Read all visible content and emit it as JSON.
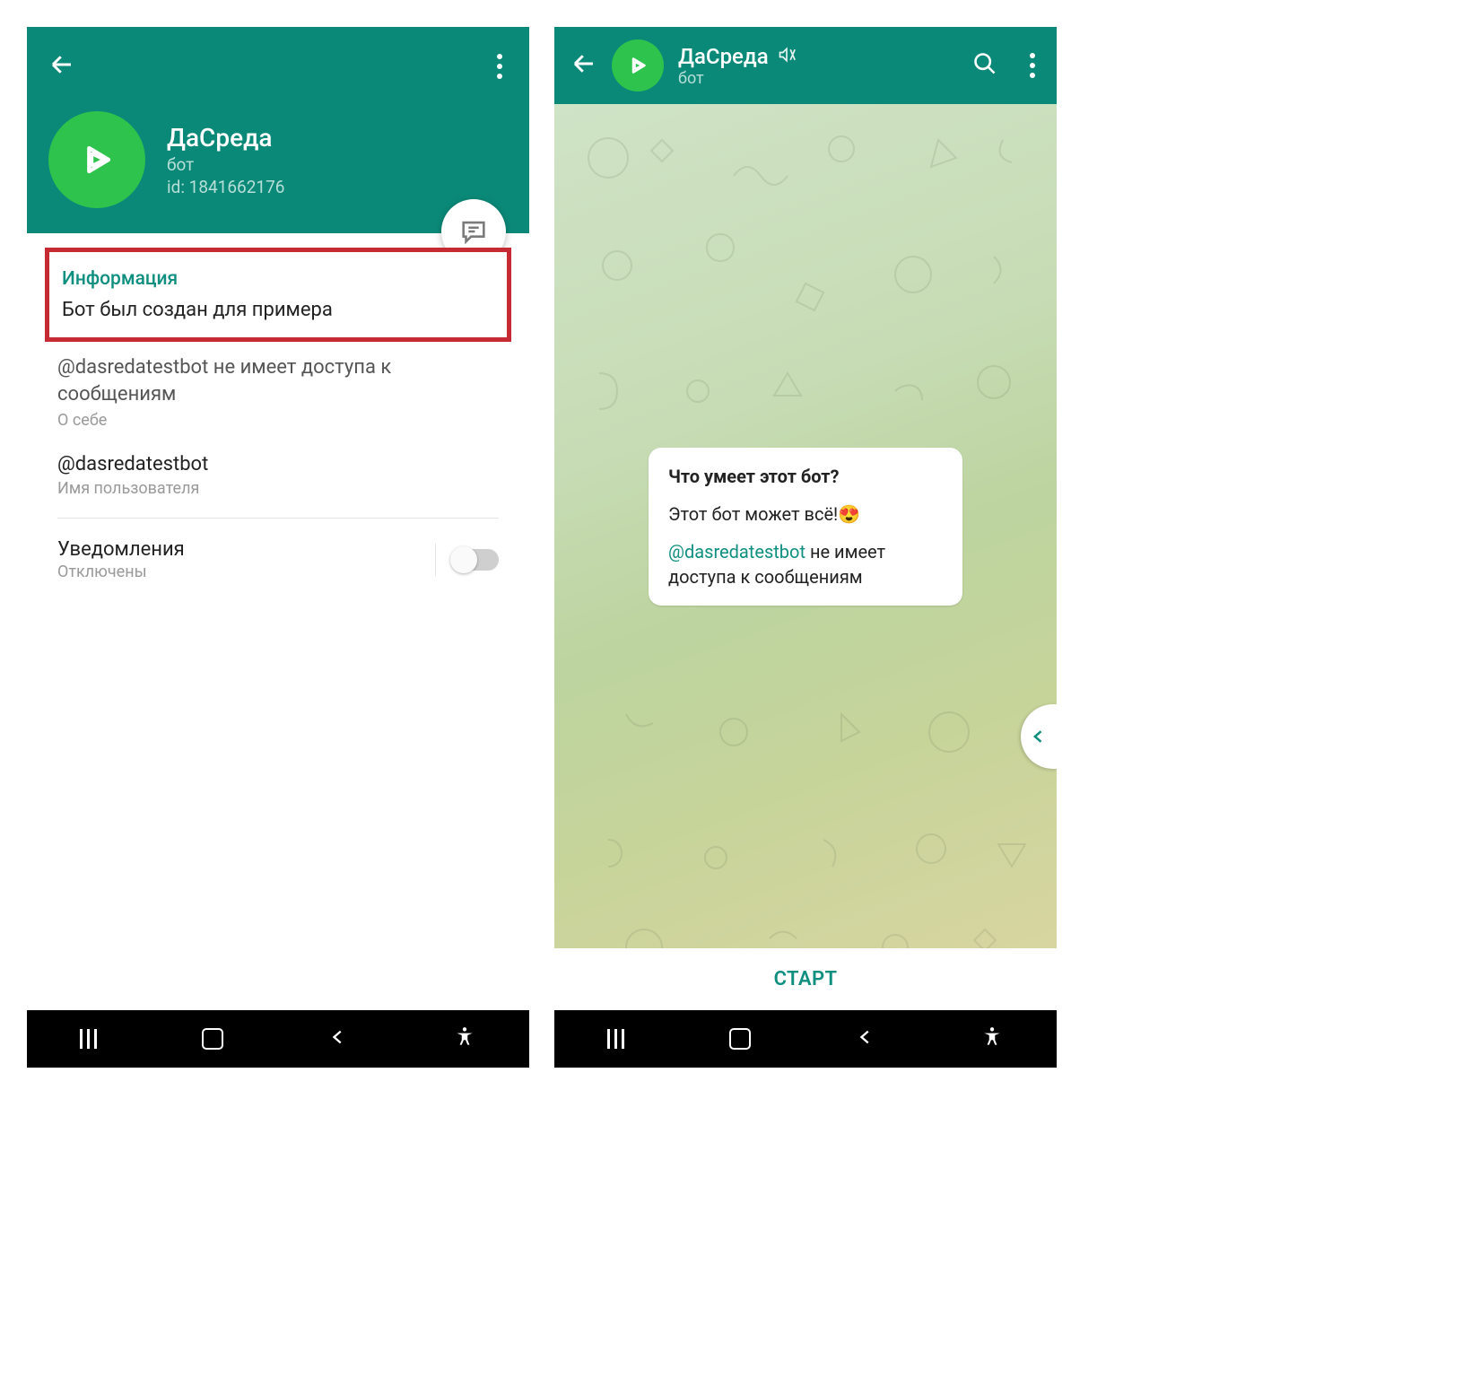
{
  "left": {
    "profile": {
      "name": "ДаСреда",
      "subtitle": "бот",
      "idLabel": "id: 1841662176"
    },
    "info": {
      "heading": "Информация",
      "description": "Бот был создан для примера"
    },
    "access": {
      "mention": "@dasredatestbot",
      "rest": " не имеет доступа к сообщениям",
      "sublabel": "О себе"
    },
    "username": {
      "value": "@dasredatestbot",
      "sublabel": "Имя пользователя"
    },
    "notifications": {
      "title": "Уведомления",
      "status": "Отключены"
    }
  },
  "right": {
    "header": {
      "name": "ДаСреда",
      "subtitle": "бот"
    },
    "message": {
      "heading": "Что умеет этот бот?",
      "body": "Этот бот может всё!",
      "emoji": "😍",
      "mention": "@dasredatestbot",
      "rest": " не имеет доступа к сообщениям"
    },
    "startLabel": "СТАРТ"
  }
}
